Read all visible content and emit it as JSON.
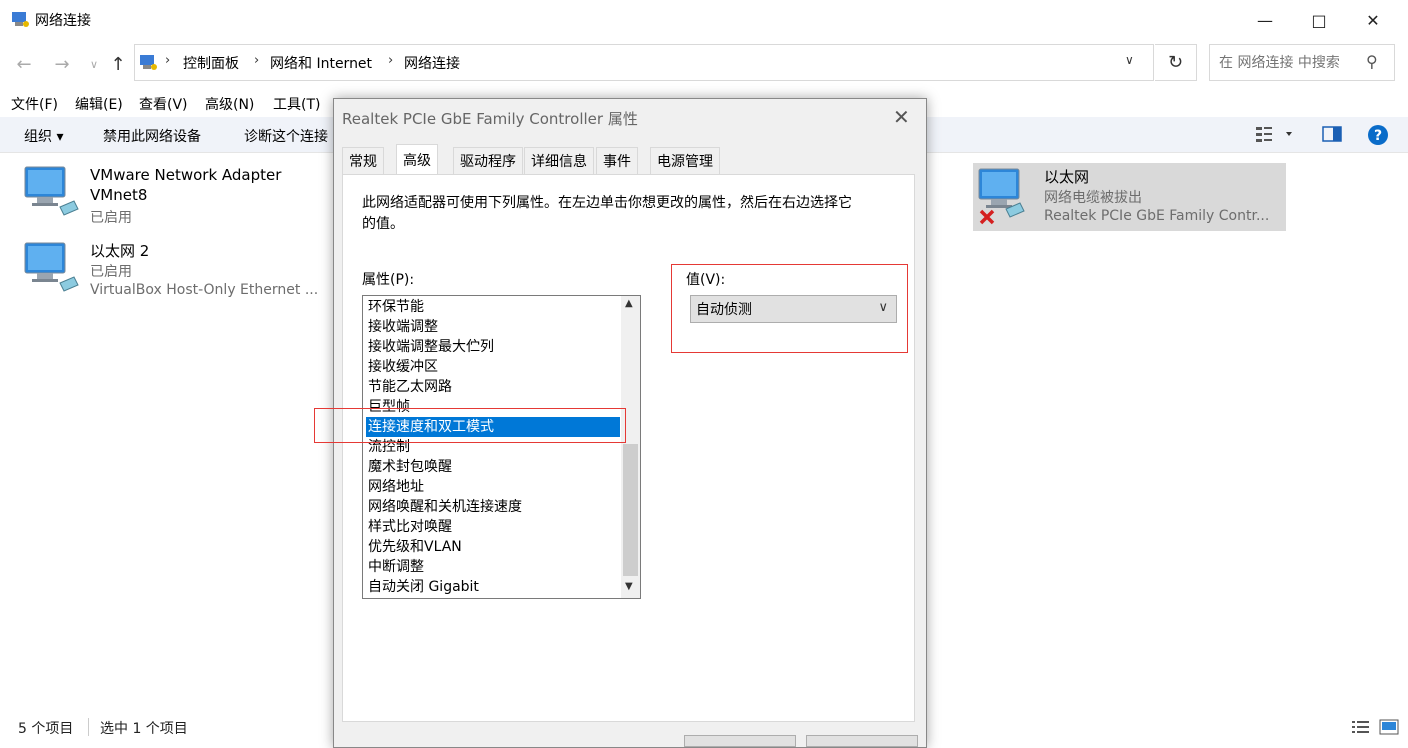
{
  "window": {
    "title": "网络连接"
  },
  "breadcrumb": [
    "控制面板",
    "网络和 Internet",
    "网络连接"
  ],
  "search": {
    "placeholder": "在 网络连接 中搜索"
  },
  "menu": [
    "文件(F)",
    "编辑(E)",
    "查看(V)",
    "高级(N)",
    "工具(T)"
  ],
  "commands": {
    "organize": "组织 ▾",
    "disable": "禁用此网络设备",
    "diagnose": "诊断这个连接"
  },
  "connections": [
    {
      "title": "VMware Network Adapter",
      "line2": "VMnet8",
      "line3": "已启用"
    },
    {
      "title": "以太网 2",
      "line2": "已启用",
      "line3": "VirtualBox Host-Only Ethernet ..."
    },
    {
      "title": "以太网",
      "line2": "网络电缆被拔出",
      "line3": "Realtek PCIe GbE Family Contr..."
    }
  ],
  "status": {
    "count": "5 个项目",
    "selected": "选中 1 个项目"
  },
  "dialog": {
    "title": "Realtek PCIe GbE Family Controller 属性",
    "tabs": [
      "常规",
      "高级",
      "驱动程序",
      "详细信息",
      "事件",
      "电源管理"
    ],
    "description": "此网络适配器可使用下列属性。在左边单击你想更改的属性，然后在右边选择它的值。",
    "property_label": "属性(P):",
    "value_label": "值(V):",
    "properties": [
      "环保节能",
      "接收端调整",
      "接收端调整最大伫列",
      "接收缓冲区",
      "节能乙太网路",
      "巨型帧",
      "连接速度和双工模式",
      "流控制",
      "魔术封包唤醒",
      "网络地址",
      "网络唤醒和关机连接速度",
      "样式比对唤醒",
      "优先级和VLAN",
      "中断调整",
      "自动关闭 Gigabit"
    ],
    "selected_property": "连接速度和双工模式",
    "value": "自动侦测"
  }
}
